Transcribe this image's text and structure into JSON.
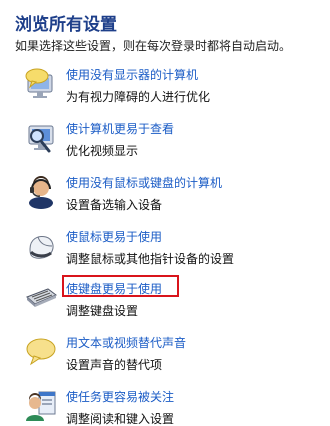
{
  "header": {
    "title": "浏览所有设置",
    "subtitle": "如果选择这些设置，则在每次登录时都将自动启动。"
  },
  "items": [
    {
      "link": "使用没有显示器的计算机",
      "desc": "为有视力障碍的人进行优化",
      "icon": "speech-bubble-monitor-icon"
    },
    {
      "link": "使计算机更易于查看",
      "desc": "优化视频显示",
      "icon": "magnifier-monitor-icon"
    },
    {
      "link": "使用没有鼠标或键盘的计算机",
      "desc": "设置备选输入设备",
      "icon": "headset-person-icon"
    },
    {
      "link": "使鼠标更易于使用",
      "desc": "调整鼠标或其他指针设备的设置",
      "icon": "mouse-icon"
    },
    {
      "link": "使键盘更易于使用",
      "desc": "调整键盘设置",
      "icon": "keyboard-icon"
    },
    {
      "link": "用文本或视频替代声音",
      "desc": "设置声音的替代项",
      "icon": "speech-bubble-icon"
    },
    {
      "link": "使任务更容易被关注",
      "desc": "调整阅读和键入设置",
      "icon": "person-window-icon"
    }
  ],
  "colors": {
    "title": "#1e3f8a",
    "link": "#1b5cc6",
    "highlight": "#d9141b"
  }
}
